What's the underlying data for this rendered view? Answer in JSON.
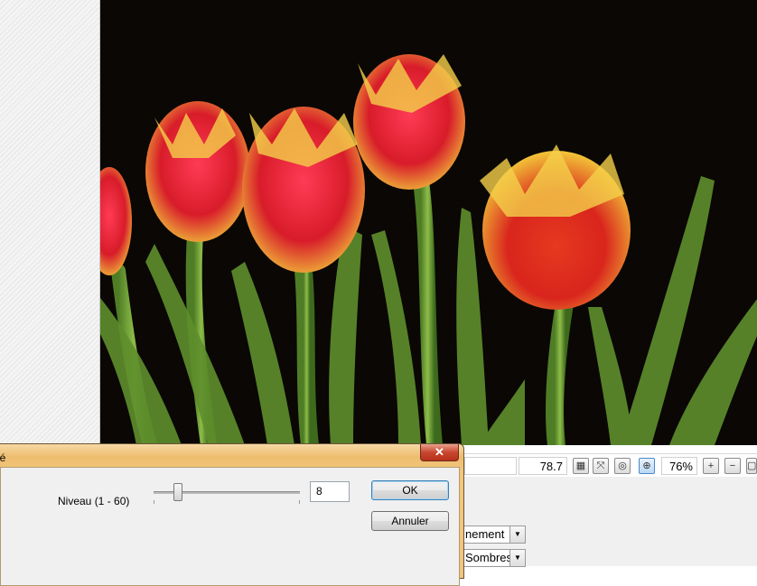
{
  "statusbar": {
    "filesize": "78.7 KB",
    "zoom": "76%",
    "icons": [
      "checker-icon",
      "fit-icon",
      "actual-size-icon",
      "zoom-fit-icon",
      "zoom-in-icon",
      "zoom-out-icon",
      "fullscreen-icon"
    ]
  },
  "dialog": {
    "title": "gé",
    "close_label": "✕",
    "niveau_label": "Niveau (1 - 60)",
    "slider": {
      "min": 1,
      "max": 60,
      "value": 8
    },
    "value": "8",
    "ok_label": "OK",
    "cancel_label": "Annuler"
  },
  "lower_panel": {
    "combo1": "nement",
    "combo2": "Sombres"
  }
}
